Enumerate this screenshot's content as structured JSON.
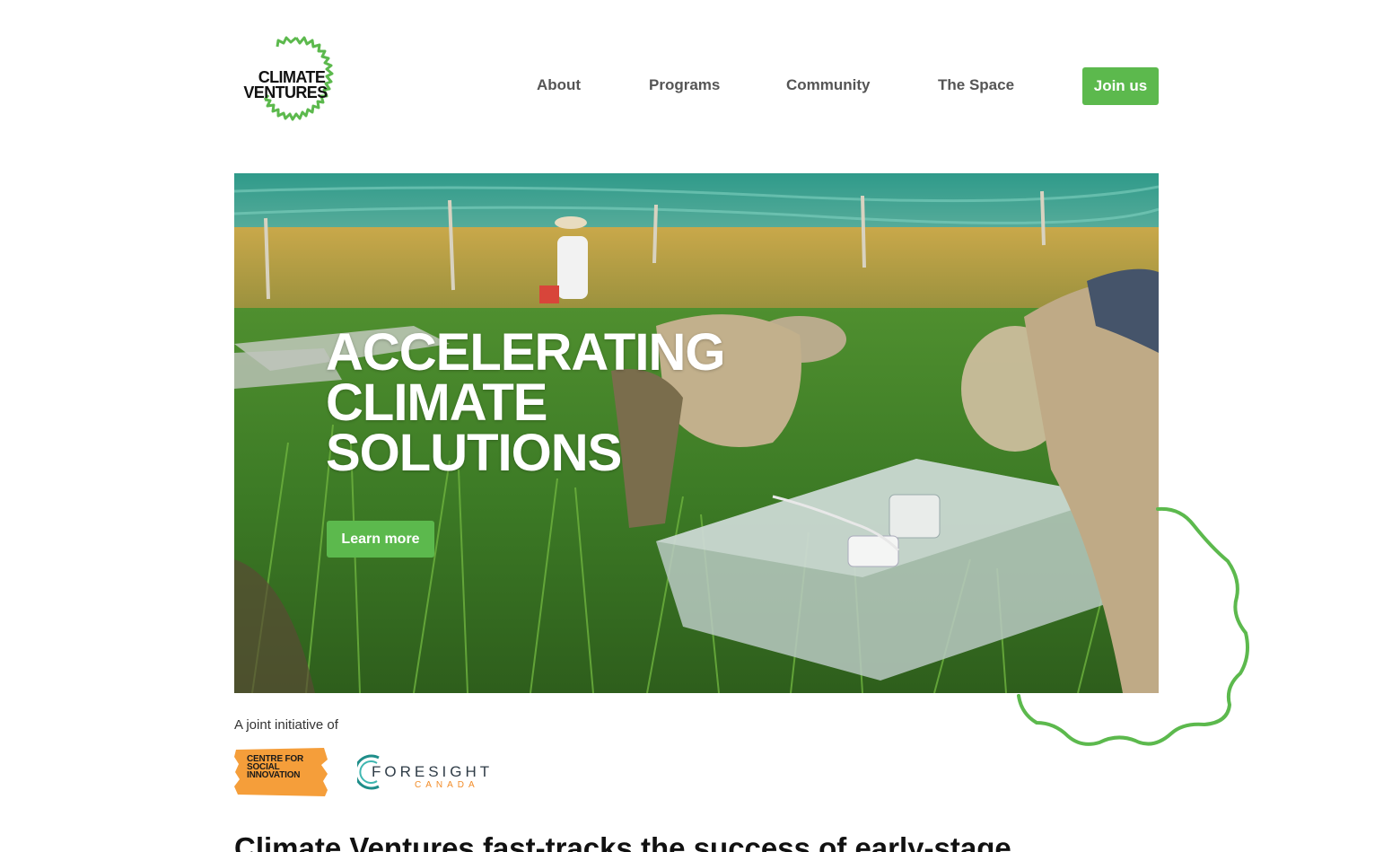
{
  "brand": {
    "logo_line1": "CLIMATE",
    "logo_line2": "VENTURES",
    "accent_color": "#5cb94d"
  },
  "nav": {
    "items": [
      {
        "label": "About"
      },
      {
        "label": "Programs"
      },
      {
        "label": "Community"
      },
      {
        "label": "The Space"
      }
    ],
    "cta_label": "Join us"
  },
  "hero": {
    "title_line1": "ACCELERATING",
    "title_line2": "CLIMATE",
    "title_line3": "SOLUTIONS",
    "button_label": "Learn more",
    "image_subject": "researchers measuring gas chamber in a rice paddy field"
  },
  "partners": {
    "label": "A joint initiative of",
    "csi_line1": "CENTRE FOR",
    "csi_line2": "SOCIAL",
    "csi_line3": "INNOVATION",
    "foresight_name": "FORESIGHT",
    "foresight_sub": "CANADA"
  },
  "intro": {
    "heading": "Climate Ventures fast-tracks the success of early-stage"
  }
}
